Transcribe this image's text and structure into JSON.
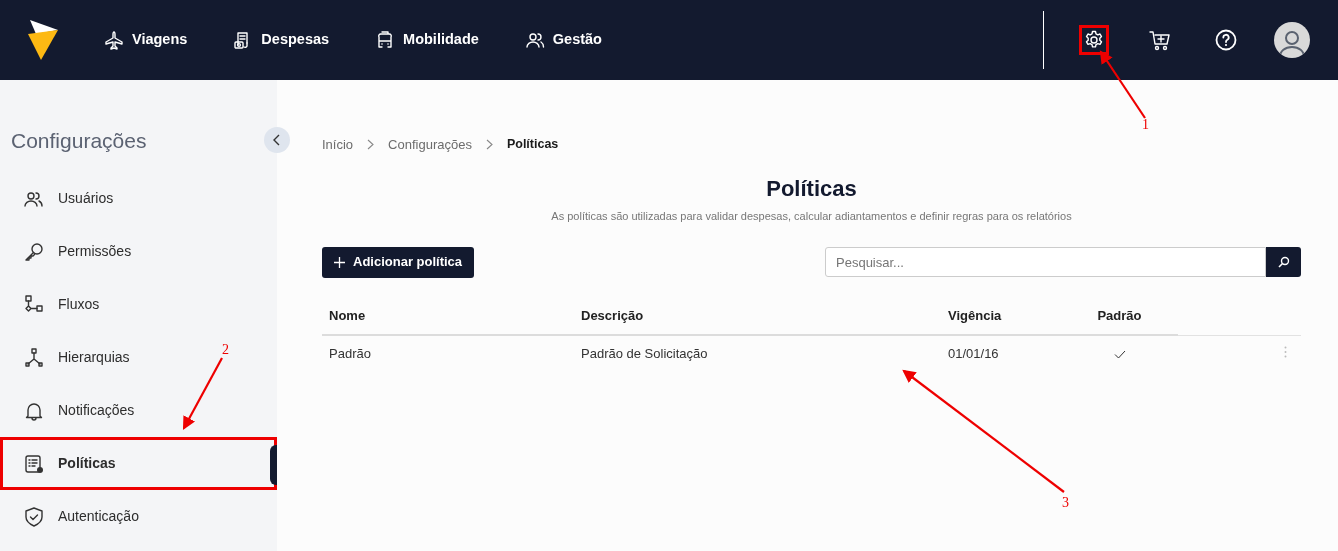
{
  "nav": {
    "items": [
      {
        "label": "Viagens"
      },
      {
        "label": "Despesas"
      },
      {
        "label": "Mobilidade"
      },
      {
        "label": "Gestão"
      }
    ]
  },
  "sidebar": {
    "title": "Configurações",
    "items": [
      {
        "label": "Usuários",
        "selected": false
      },
      {
        "label": "Permissões",
        "selected": false
      },
      {
        "label": "Fluxos",
        "selected": false
      },
      {
        "label": "Hierarquias",
        "selected": false
      },
      {
        "label": "Notificações",
        "selected": false
      },
      {
        "label": "Políticas",
        "selected": true
      },
      {
        "label": "Autenticação",
        "selected": false
      }
    ]
  },
  "breadcrumb": [
    {
      "label": "Início",
      "current": false
    },
    {
      "label": "Configurações",
      "current": false
    },
    {
      "label": "Políticas",
      "current": true
    }
  ],
  "page": {
    "title": "Políticas",
    "subtitle": "As políticas são utilizadas para validar despesas, calcular adiantamentos e definir regras para os relatórios"
  },
  "add_button": "Adicionar política",
  "search": {
    "placeholder": "Pesquisar..."
  },
  "table": {
    "columns": [
      "Nome",
      "Descrição",
      "Vigência",
      "Padrão"
    ],
    "rows": [
      {
        "nome": "Padrão",
        "descricao": "Padrão de Solicitação",
        "vigencia": "01/01/16",
        "padrao": true
      }
    ]
  },
  "annotations": [
    {
      "label": "1"
    },
    {
      "label": "2"
    },
    {
      "label": "3"
    }
  ]
}
